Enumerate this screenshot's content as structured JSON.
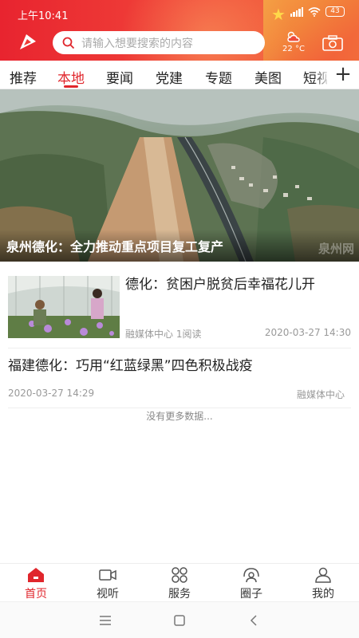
{
  "status": {
    "time": "上午10:41",
    "battery": "43"
  },
  "search": {
    "placeholder": "请输入想要搜索的内容"
  },
  "weather": {
    "temp": "22 °C"
  },
  "tabs": [
    {
      "label": "推荐"
    },
    {
      "label": "本地"
    },
    {
      "label": "要闻"
    },
    {
      "label": "党建"
    },
    {
      "label": "专题"
    },
    {
      "label": "美图"
    },
    {
      "label": "短视"
    }
  ],
  "active_tab": "本地",
  "colors": {
    "accent": "#e0262c",
    "header": "#ee3a35"
  },
  "hero": {
    "caption": "泉州德化：全力推动重点项目复工复产",
    "watermark": "泉州网"
  },
  "news": [
    {
      "title": "德化：贫困户脱贫后幸福花儿开",
      "source": "融媒体中心 1阅读",
      "date": "2020-03-27 14:30"
    },
    {
      "title": "福建德化：巧用“红蓝绿黑”四色积极战疫",
      "date": "2020-03-27 14:29",
      "source": "融媒体中心"
    }
  ],
  "no_more": "没有更多数据...",
  "bottom_nav": [
    {
      "label": "首页",
      "icon": "home-icon"
    },
    {
      "label": "视听",
      "icon": "video-icon"
    },
    {
      "label": "服务",
      "icon": "grid-icon"
    },
    {
      "label": "圈子",
      "icon": "circle-community-icon"
    },
    {
      "label": "我的",
      "icon": "person-icon"
    }
  ]
}
